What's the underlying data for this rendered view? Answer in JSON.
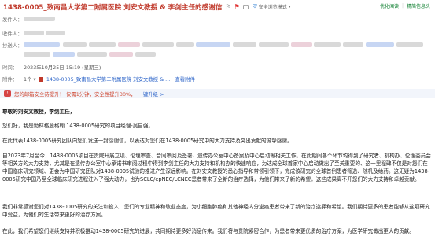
{
  "email": {
    "subject": "1438-0005_致南昌大学第二附属医院 刘安文教授 & 李剑主任的感谢信",
    "security_label": "安全浏览模式",
    "top_links": [
      "优化阅读",
      "精简信息头"
    ],
    "labels": {
      "sender": "发件人：",
      "recipient": "收件人：",
      "cc": "抄送人：",
      "time": "时间：",
      "attachment": "附件："
    },
    "time_value": "2023年10月25日 15:19 (星期三)",
    "attachment": {
      "count": "1个",
      "file_name": "1438-0005_致南昌大学第二附属医院 刘安文教授 & ...",
      "view_label": "查看附件"
    }
  },
  "banner": {
    "text": "您的邮箱安全待提升！ 仅需1分钟，安全性提升30%，",
    "link": "一键升级 >"
  },
  "body": {
    "greeting": "尊敬的刘安文教授，李剑主任，",
    "paragraphs": [
      "您们好，我是勃林格殷格翰 1438-0005研究的项目经理-吴自强。",
      "在此代表1438-0005研究团队向您们发送一封感谢信，以表达对您们在1438-0005研究中的大力支持及突出贡献的诚挚感谢。",
      "自2023年7月至今，1438-0005项目在贵院开展立项、伦理审查、合同审阅及签署、遗传办公室中心备案及中心启动等相关工作。在此期间各个环节均得到了研究者、机构办、伦理委员会等相关方的大力支持，尤其是在遗传办公室中心承诺书审阅过程中得到李剑主任的大力支持和机构办的快速响应，为达成全球首家中心启动做出了至关重要的、这一里程碑不仅是对您们在中国临床研究领域、更会为中国研究团队对1438-0005试验的推进产生深远影响。在刘安文教授的悉心指导和带领引领下，完成该研究的全球首例患者筛选、随机及给药。这无疑为1438-0005研究中国乃至全球临床研究进程注入了强大动力，也为SCLC/epNEC/LCNEC患者带来了全新的治疗选择，为他们带来了新的希望。这些成果离不开您们的大力支持和卓越贡献。",
      "我们非常感谢您们对1438-0005研究的关注和投入，您们的专业精神和敬业态度，为小细胞肺癌和其他神经内分泌癌患者带来了新的治疗选择和希望。我们期待更多的患者能够从这项研究中受益，为他们的生活带来更好的治疗方案。",
      "在此，我们希望您们继续支持并积极推动1438-0005研究的进展，共同期待更多好消息传来。我们将与贵院紧密合作，为患者带来更优质的治疗方案，为医学研究做出更大的贡献。"
    ]
  },
  "colors": {
    "subject": "#c0392b",
    "link": "#2b63c8",
    "green_link": "#0a7d2c",
    "banner_bg": "#f2f5fb"
  }
}
